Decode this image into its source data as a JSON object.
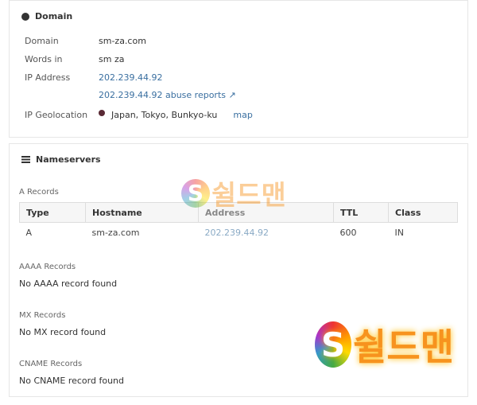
{
  "domain_panel": {
    "title": "Domain",
    "icon": "globe-icon",
    "rows": [
      {
        "label": "Domain",
        "value": "sm-za.com"
      },
      {
        "label": "Words in",
        "value": "sm za"
      },
      {
        "label": "IP Address",
        "value": "202.239.44.92"
      }
    ],
    "abuse_link": "202.239.44.92 abuse reports",
    "geo_label": "IP Geolocation",
    "geo_value": "Japan, Tokyo, Bunkyo-ku",
    "map_link": "map"
  },
  "ns_panel": {
    "title": "Nameservers",
    "icon": "server-icon",
    "a_title": "A Records",
    "columns": [
      "Type",
      "Hostname",
      "Address",
      "TTL",
      "Class"
    ],
    "rows": [
      [
        "A",
        "sm-za.com",
        "202.239.44.92",
        "600",
        "IN"
      ]
    ],
    "aaaa_title": "AAAA Records",
    "aaaa_empty": "No AAAA record found",
    "mx_title": "MX Records",
    "mx_empty": "No MX record found",
    "cname_title": "CNAME Records",
    "cname_empty": "No CNAME record found"
  },
  "watermark": {
    "text": "S쉴드맨",
    "color": "#f7931e"
  },
  "colors": {
    "link": "#3a6fa0"
  }
}
